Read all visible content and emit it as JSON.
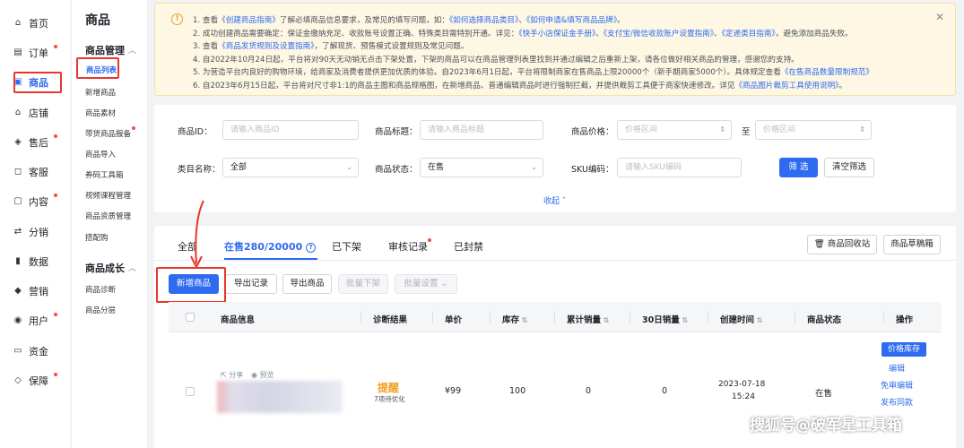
{
  "nav_primary": [
    {
      "label": "首页",
      "icon": "home-icon",
      "glyph": "⌂"
    },
    {
      "label": "订单",
      "icon": "order-icon",
      "glyph": "▤",
      "dot": true
    },
    {
      "label": "商品",
      "icon": "product-icon",
      "glyph": "▣",
      "active": true
    },
    {
      "label": "店铺",
      "icon": "store-icon",
      "glyph": "⌂"
    },
    {
      "label": "售后",
      "icon": "aftersale-icon",
      "glyph": "◈",
      "dot": true
    },
    {
      "label": "客服",
      "icon": "service-icon",
      "glyph": "◻"
    },
    {
      "label": "内容",
      "icon": "content-icon",
      "glyph": "▢",
      "dot": true
    },
    {
      "label": "分销",
      "icon": "distribution-icon",
      "glyph": "⇄"
    },
    {
      "label": "数据",
      "icon": "data-icon",
      "glyph": "▮"
    },
    {
      "label": "营销",
      "icon": "marketing-icon",
      "glyph": "◆"
    },
    {
      "label": "用户",
      "icon": "user-icon",
      "glyph": "◉",
      "dot": true
    },
    {
      "label": "资金",
      "icon": "funds-icon",
      "glyph": "▭"
    },
    {
      "label": "保障",
      "icon": "shield-icon",
      "glyph": "◇",
      "dot": true
    }
  ],
  "nav_secondary": {
    "title": "商品",
    "group1": "商品管理",
    "group1_items": [
      "商品列表",
      "新增商品",
      "商品素材",
      "带货商品报备",
      "商品导入",
      "券码工具箱",
      "视频课程管理",
      "商品资质管理",
      "搭配购"
    ],
    "group2": "商品成长",
    "group2_items": [
      "商品诊断",
      "商品分层"
    ]
  },
  "notice": {
    "lines": [
      [
        [
          "1. 查看",
          0
        ],
        [
          "《创建商品指南》",
          1
        ],
        [
          "了解必填商品信息要求，及常见的填写问题，如：",
          0
        ],
        [
          "《如何选择商品类目》",
          1
        ],
        [
          "、",
          0
        ],
        [
          "《如何申请&填写商品品牌》",
          1
        ],
        [
          "。",
          0
        ]
      ],
      [
        [
          "2. 成功创建商品需要确定：保证金缴纳充足、收款账号设置正确、特殊类目需特别开通。详见：",
          0
        ],
        [
          "《快手小店保证金手册》",
          1
        ],
        [
          "、",
          0
        ],
        [
          "《支付宝/微信收款账户设置指南》",
          1
        ],
        [
          "、",
          0
        ],
        [
          "《定递类目指南》",
          1
        ],
        [
          "，避免添加商品失败。",
          0
        ]
      ],
      [
        [
          "3. 查看",
          0
        ],
        [
          "《商品发货规则及设置指南》",
          1
        ],
        [
          "，了解现货、预售模式设置规则及常见问题。",
          0
        ]
      ],
      [
        [
          "4. 自2022年10月24日起，平台将对90天无动销无点击下架处置，下架的商品可以在商品管理列表里找到并通过编辑之后重新上架，请各位做好相关商品的管理，感谢您的支持。",
          0
        ]
      ],
      [
        [
          "5. 为营造平台内良好的购物环境，给商家及消费者提供更加优质的体验。自2023年6月1日起，平台将限制商家在售商品上限20000个（新手期商家5000个）。具体规定查看",
          0
        ],
        [
          "《在售商品数量限制规范》",
          1
        ]
      ],
      [
        [
          "6. 自2023年6月15日起，平台将对尺寸非1:1的商品主图和商品规格图，在新增商品、普通编辑商品时进行强制拦截，并提供裁剪工具便于商家快速修改。详见",
          0
        ],
        [
          "《商品图片裁剪工具使用说明》",
          1
        ],
        [
          "。",
          0
        ]
      ]
    ]
  },
  "filter": {
    "id_label": "商品ID：",
    "id_placeholder": "请输入商品ID",
    "title_label": "商品标题：",
    "title_placeholder": "请输入商品标题",
    "price_label": "商品价格：",
    "price_from": "价格区间",
    "price_to_sep": "至",
    "price_to": "价格区间",
    "cat_label": "类目名称：",
    "cat_value": "全部",
    "status_label": "商品状态：",
    "status_value": "在售",
    "sku_label": "SKU编码：",
    "sku_placeholder": "请输入SKU编码",
    "filter_btn": "筛 选",
    "clear_btn": "清空筛选",
    "collapse": "收起"
  },
  "tabs": [
    "全部",
    "在售280/20000",
    "已下架",
    "审核记录",
    "已封禁"
  ],
  "tab_help": "?",
  "recycle_btn": "商品回收站",
  "draft_btn": "商品草稿箱",
  "actions": {
    "add": "新增商品",
    "export_record": "导出记录",
    "export": "导出商品",
    "batch_off": "批量下架",
    "batch_set": "批量设置"
  },
  "columns": [
    "商品信息",
    "诊断结果",
    "单价",
    "库存",
    "累计销量",
    "30日销量",
    "创建时间",
    "商品状态",
    "操作"
  ],
  "row": {
    "share": "分享",
    "preview": "预览",
    "diag": "提醒",
    "diag_sub": "7项待优化",
    "price": "¥99",
    "stock": "100",
    "sales_total": "0",
    "sales_30": "0",
    "created_date": "2023-07-18",
    "created_time": "15:24",
    "status": "在售",
    "ops": [
      "价格库存",
      "编辑",
      "免审编辑",
      "发布同款"
    ]
  },
  "watermark": "搜狐号@破军星工具箱",
  "colors": {
    "accent": "#2f6bf1",
    "highlight": "#e8362f",
    "notice_bg": "#fdf7e4",
    "warn": "#f0a020"
  }
}
